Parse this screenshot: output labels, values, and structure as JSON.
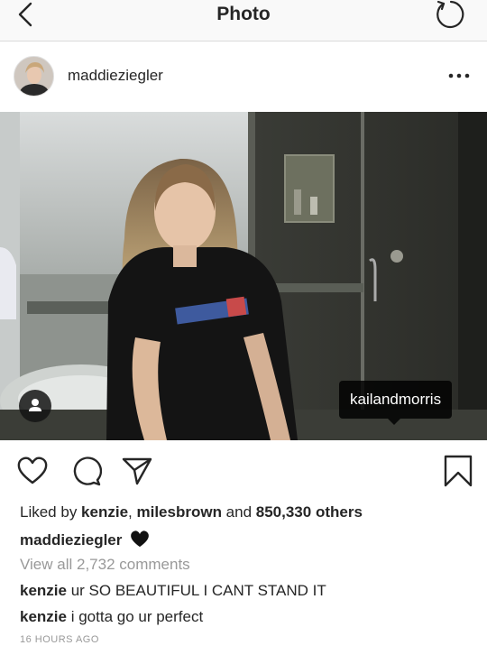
{
  "navbar": {
    "title": "Photo"
  },
  "post": {
    "username": "maddieziegler",
    "tag_label": "kailandmorris",
    "likes": {
      "prefix": "Liked by ",
      "user1": "kenzie",
      "separator": ", ",
      "user2": "milesbrown",
      "conjunction": " and ",
      "count": "850,330 others"
    },
    "caption_user": "maddieziegler",
    "caption_emoji": "black-heart",
    "view_all": "View all 2,732 comments",
    "comments": [
      {
        "user": "kenzie",
        "text": "ur SO BEAUTIFUL I CANT STAND IT"
      },
      {
        "user": "kenzie",
        "text": "i gotta go ur perfect"
      }
    ],
    "timestamp": "16 HOURS AGO"
  },
  "icons": {
    "back": "chevron-left-icon",
    "refresh": "refresh-icon",
    "more": "more-horizontal-icon",
    "like": "heart-icon",
    "comment": "comment-bubble-icon",
    "share": "paper-plane-icon",
    "save": "bookmark-icon",
    "tag": "person-icon"
  }
}
